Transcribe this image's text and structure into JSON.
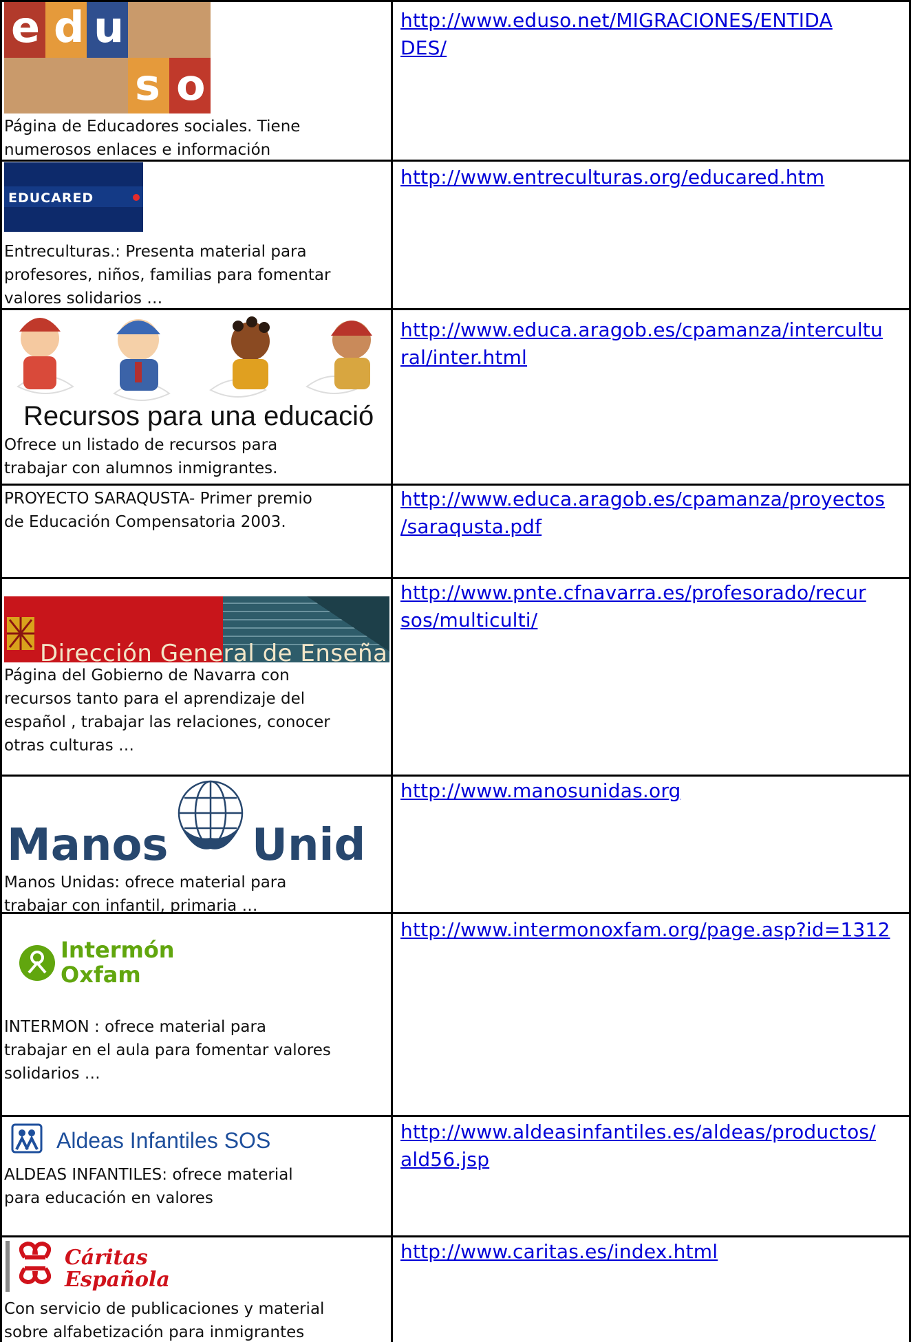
{
  "rows": [
    {
      "logo_text": [
        "e",
        "d",
        "u",
        "s",
        "o"
      ],
      "desc": "Página  de Educadores sociales. Tiene\nnumerosos enlaces e información",
      "url": "http://www.eduso.net/MIGRACIONES/ENTIDA\nDES/"
    },
    {
      "logo_text": "EDUCARED",
      "desc": "Entreculturas.: Presenta material para\nprofesores, niños, familias para fomentar\nvalores solidarios …",
      "url": "http://www.entreculturas.org/educared.htm"
    },
    {
      "logo_text": "Recursos para una educació",
      "desc": "Ofrece un listado de recursos para\ntrabajar con alumnos inmigrantes.",
      "url": "http://www.educa.aragob.es/cpamanza/intercultu\nral/inter.html"
    },
    {
      "desc": "PROYECTO SARAQUSTA- Primer premio\nde Educación Compensatoria 2003.",
      "url": "http://www.educa.aragob.es/cpamanza/proyectos\n/saraqusta.pdf"
    },
    {
      "logo_text": "Dirección General de Enseñanzas Escol",
      "desc": "Página del Gobierno de Navarra con\nrecursos tanto para el aprendizaje del\nespañol , trabajar las relaciones, conocer\notras culturas  …",
      "url": "http://www.pnte.cfnavarra.es/profesorado/recur\nsos/multiculti/"
    },
    {
      "logo_text": [
        "Manos",
        "Unid"
      ],
      "desc": "Manos Unidas: ofrece material para\ntrabajar con infantil, primaria …",
      "url": "http://www.manosunidas.org"
    },
    {
      "logo_text": [
        "Intermón",
        "Oxfam"
      ],
      "desc": "INTERMON : ofrece material para\ntrabajar en el aula para fomentar valores\nsolidarios …",
      "url": "http://www.intermonoxfam.org/page.asp?id=1312"
    },
    {
      "logo_text": "Aldeas Infantiles SOS",
      "desc": "ALDEAS INFANTILES: ofrece material\npara educación en valores",
      "url": "http://www.aldeasinfantiles.es/aldeas/productos/\nald56.jsp"
    },
    {
      "logo_text": [
        "Cáritas",
        "Española"
      ],
      "desc": "Con servicio de publicaciones y material\nsobre alfabetización para inmigrantes",
      "url": "http://www.caritas.es/index.html"
    }
  ],
  "colors": {
    "link": "#0000d8",
    "eduso_red": "#b23a2b",
    "eduso_orange": "#e59a3b",
    "eduso_blue": "#2f4f8f",
    "eduso_tan": "#c99a6b",
    "navarra_red": "#c8151b",
    "caritas_red": "#d0121b",
    "oxfam_green": "#61a60e",
    "manos_blue": "#27476e"
  }
}
